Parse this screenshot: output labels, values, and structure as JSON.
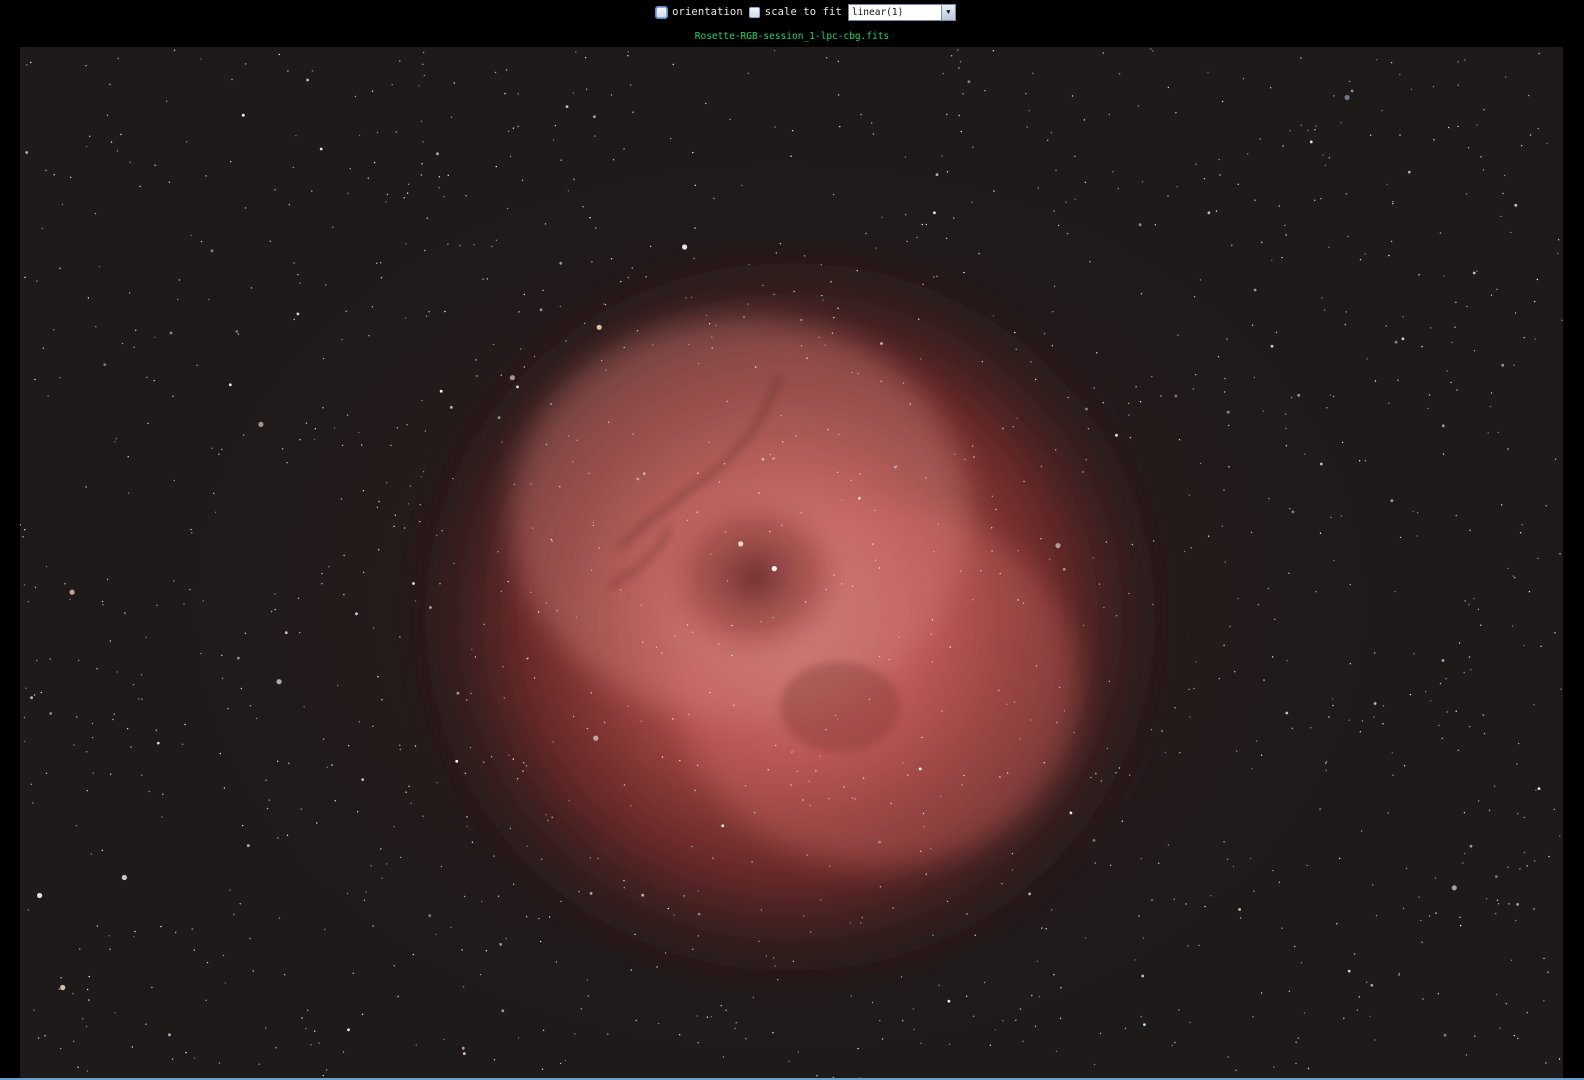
{
  "toolbar": {
    "orientation_label": "orientation",
    "scale_label": "scale to fit",
    "stretch_select": {
      "value": "linear(1)"
    }
  },
  "viewer": {
    "filename": "Rosette-RGB-session_1-lpc-cbg.fits",
    "colors": {
      "sky": "#1f1a1a",
      "nebula": "#c24a48",
      "nebula_core": "#d98a86",
      "label": "#22d36a"
    }
  }
}
